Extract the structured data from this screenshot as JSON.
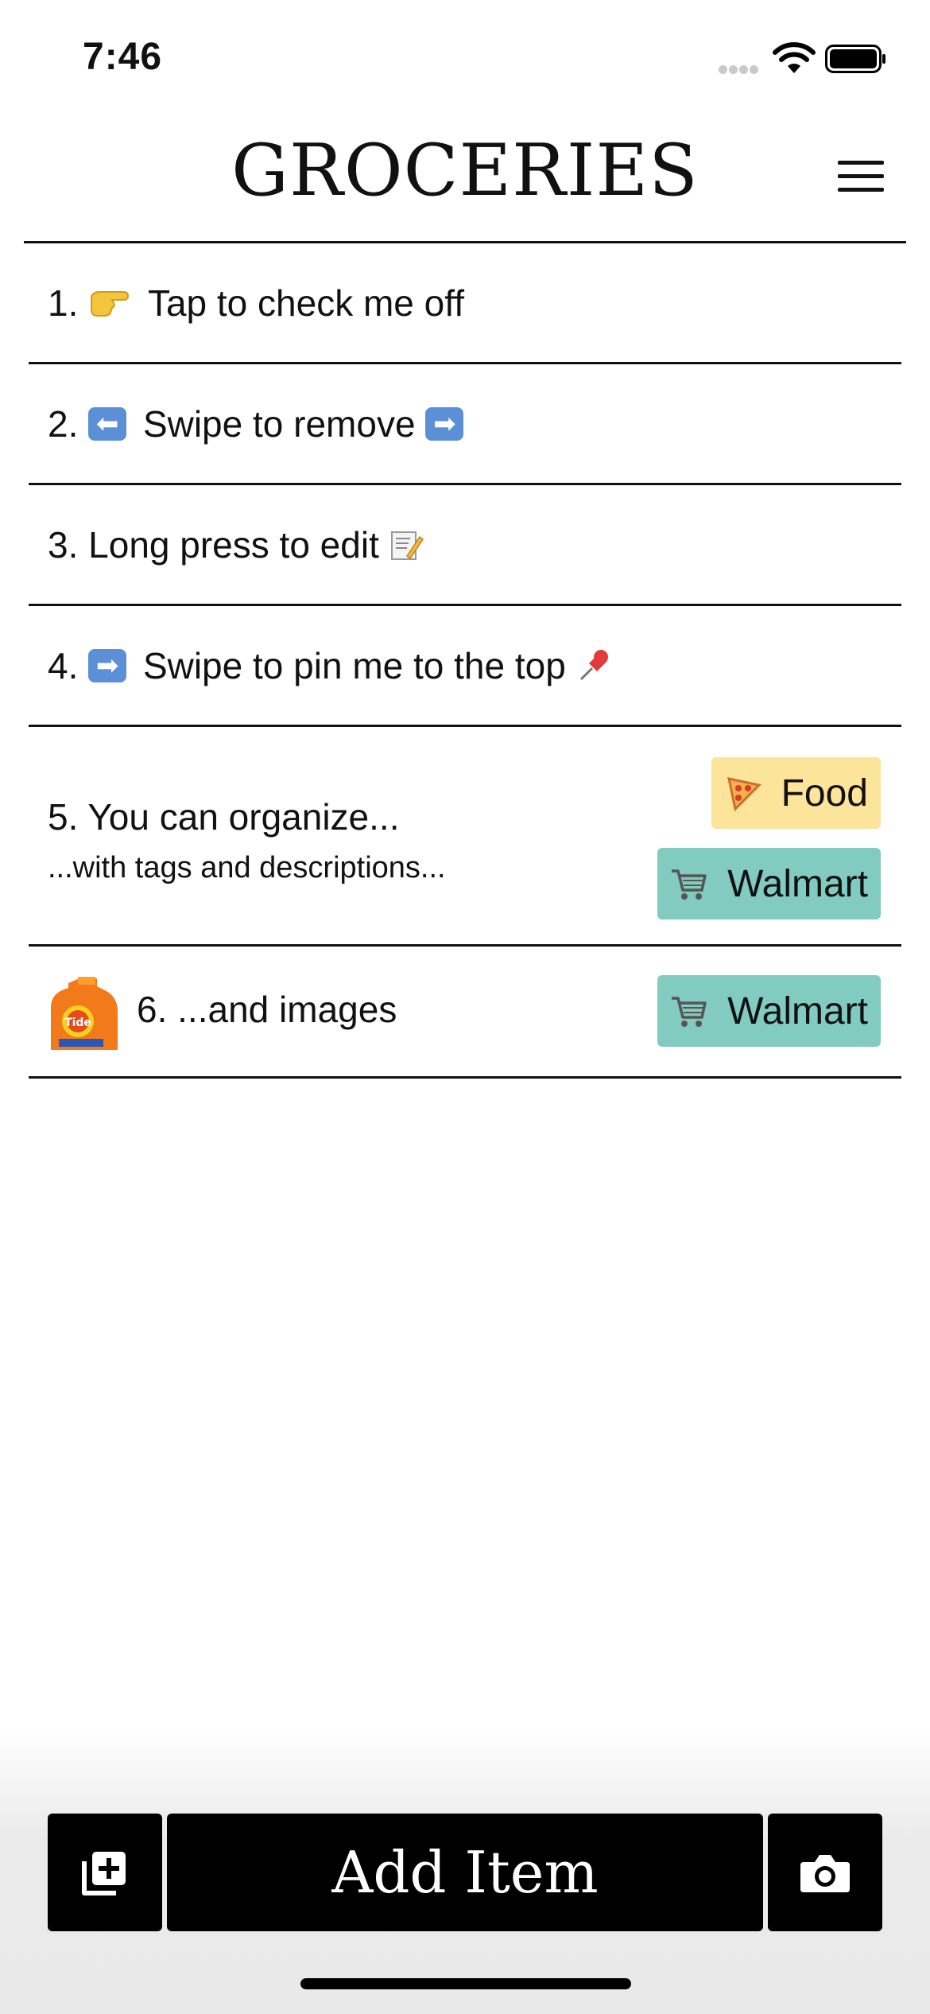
{
  "status_bar": {
    "time": "7:46"
  },
  "header": {
    "title": "GROCERIES"
  },
  "items": [
    {
      "number": "1.",
      "text": "Tap to check me off"
    },
    {
      "number": "2.",
      "text": "Swipe to remove"
    },
    {
      "number": "3.",
      "text": "Long press to edit"
    },
    {
      "number": "4.",
      "text": "Swipe to pin me to the top"
    },
    {
      "number": "5.",
      "text": "You can organize...",
      "description": "...with tags and descriptions...",
      "tags": [
        {
          "label": "Food",
          "icon": "pizza-icon",
          "color": "#fce49a"
        },
        {
          "label": "Walmart",
          "icon": "cart-icon",
          "color": "#81cbc1"
        }
      ]
    },
    {
      "number": "6.",
      "text": "...and images",
      "image": "detergent-bottle",
      "tags": [
        {
          "label": "Walmart",
          "icon": "cart-icon",
          "color": "#81cbc1"
        }
      ]
    }
  ],
  "bottom_bar": {
    "add_item_label": "Add Item"
  }
}
